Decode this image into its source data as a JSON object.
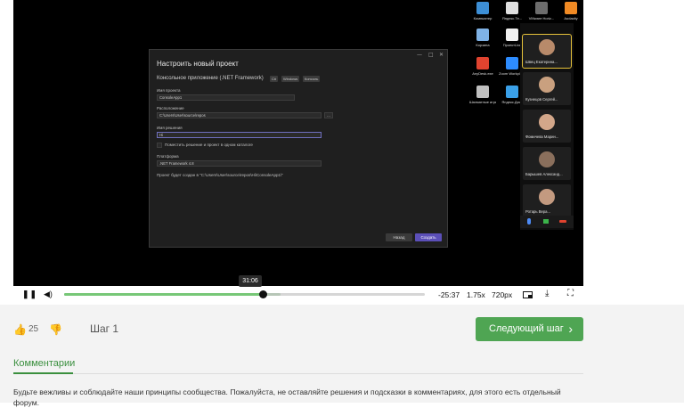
{
  "vs_dialog": {
    "title": "Настроить новый проект",
    "subtitle": "Консольное приложение (.NET Framework)",
    "tags": [
      "C#",
      "Windows",
      "Консоль"
    ],
    "project_name_label": "Имя проекта",
    "project_name_value": "ConsoleApp1",
    "location_label": "Расположение",
    "location_value": "C:\\Users\\User\\source\\repos",
    "solution_name_label": "Имя решения",
    "solution_name_value": "Hi",
    "same_dir_checkbox_label": "Поместить решение и проект в одном каталоге",
    "framework_label": "Платформа",
    "framework_value": ".NET Framework 4.8",
    "path_note": "Проект будет создан в \"C:\\Users\\User\\source\\repos\\Hi\\ConsoleApp1\\\"",
    "back_button": "Назад",
    "create_button": "Создать",
    "window_controls": [
      "—",
      "□",
      "✕"
    ]
  },
  "desktop_icons": [
    {
      "caption": "Компьютер",
      "color": "#3d8fd6"
    },
    {
      "caption": "Яндекс.Те...",
      "color": "#e0e0e0"
    },
    {
      "caption": "VMware Horiz...",
      "color": "#6d6d6d"
    },
    {
      "caption": "Audacity",
      "color": "#f08a24"
    },
    {
      "caption": "Camtasia 9",
      "color": "#3bb34a"
    },
    {
      "caption": "Корзина",
      "color": "#7fb2e6"
    },
    {
      "caption": "ПроектLive",
      "color": "#f0f0f0"
    },
    {
      "caption": "AnyDesk.exe",
      "color": "#e0432f"
    },
    {
      "caption": "Zoom Workplace",
      "color": "#2d8cff"
    },
    {
      "caption": "Шахматные игры-уроки...",
      "color": "#c0c0c0"
    },
    {
      "caption": "Яндекс.Диск",
      "color": "#3aa0e8"
    }
  ],
  "participants": [
    {
      "name": "Швец Екатерина...",
      "face": "#b88a6a",
      "active": true
    },
    {
      "name": "Кузнецов Сергей...",
      "face": "#c9a07f",
      "active": false
    },
    {
      "name": "Фомичева Марин...",
      "face": "#d3a78a",
      "active": false
    },
    {
      "name": "Барышев Александ...",
      "face": "#8a6f5c",
      "active": false
    },
    {
      "name": "Ротарь Вера...",
      "face": "#c39a80",
      "active": false
    }
  ],
  "player": {
    "tooltip_time": "31:06",
    "played_fraction": 0.551,
    "buffered_fraction": 0.6,
    "remaining_time": "-25:37",
    "speed": "1.75x",
    "quality": "720px",
    "play_pause_icon": "pause-icon",
    "volume_icon": "volume-icon",
    "pip_icon": "picture-in-picture-icon",
    "download_icon": "download-icon",
    "fullscreen_icon": "fullscreen-icon"
  },
  "step": {
    "likes": "25",
    "label": "Шаг 1",
    "next_button": "Следующий шаг"
  },
  "comments": {
    "tab_label": "Комментарии",
    "notice": "Будьте вежливы и соблюдайте наши принципы сообщества. Пожалуйста, не оставляйте решения и подсказки в комментариях, для этого есть отдельный форум."
  },
  "colors": {
    "accent_green": "#4fa553",
    "progress_played": "#77c777"
  }
}
